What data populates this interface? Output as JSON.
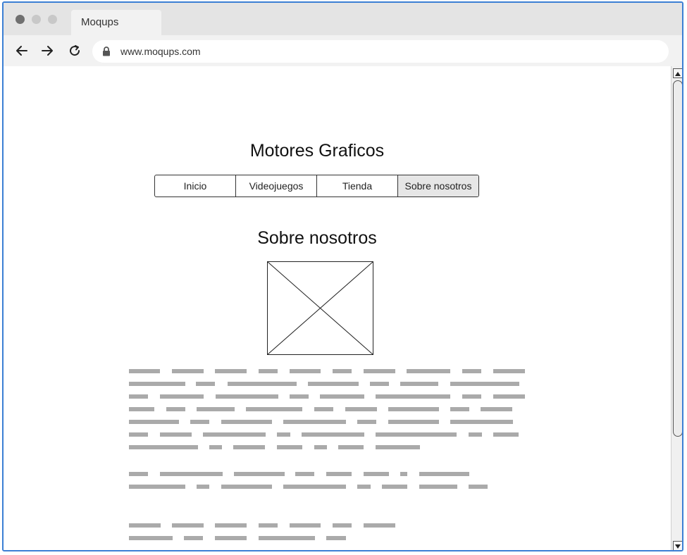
{
  "browser": {
    "tab_title": "Moqups",
    "url": "www.moqups.com"
  },
  "page": {
    "site_title": "Motores Graficos",
    "menu": [
      {
        "label": "Inicio",
        "active": false
      },
      {
        "label": "Videojuegos",
        "active": false
      },
      {
        "label": "Tienda",
        "active": false
      },
      {
        "label": "Sobre nosotros",
        "active": true
      }
    ],
    "section_title": "Sobre nosotros"
  },
  "icons": [
    "back-arrow-icon",
    "forward-arrow-icon",
    "reload-icon",
    "lock-icon",
    "image-placeholder-icon"
  ],
  "colors": {
    "window_border": "#3b7fd4",
    "placeholder_text": "#aaaaaa",
    "active_menu": "#e6e6e6"
  }
}
